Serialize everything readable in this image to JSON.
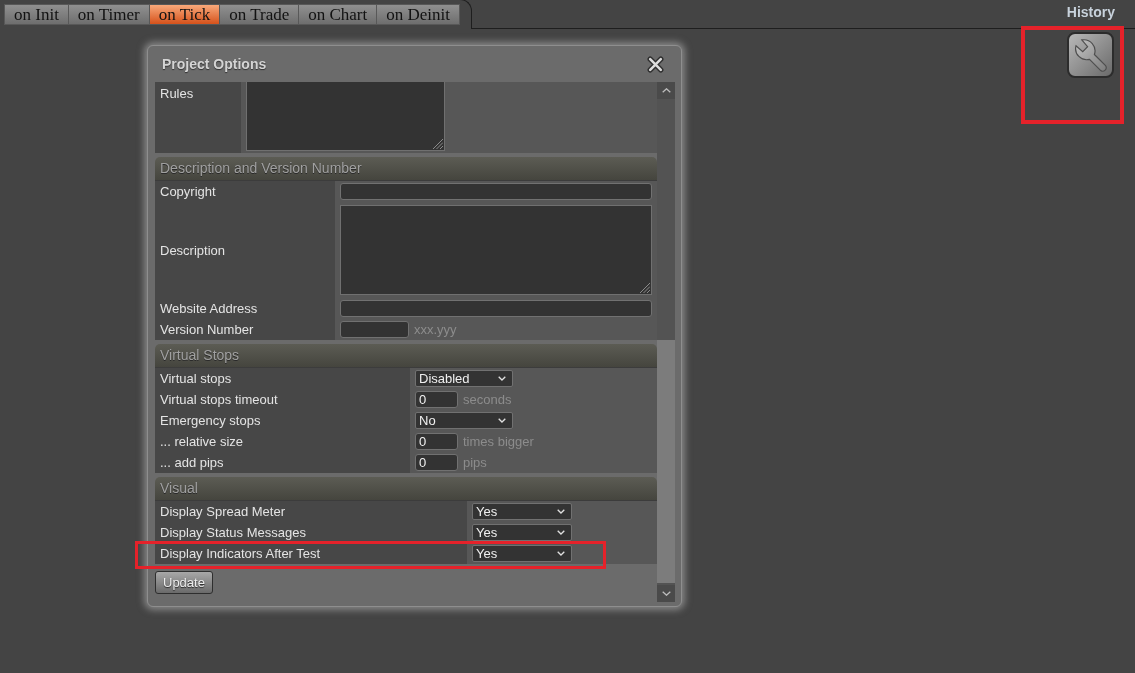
{
  "tabs": [
    {
      "label": "on Init",
      "selected": false
    },
    {
      "label": "on Timer",
      "selected": false
    },
    {
      "label": "on Tick",
      "selected": true
    },
    {
      "label": "on Trade",
      "selected": false
    },
    {
      "label": "on Chart",
      "selected": false
    },
    {
      "label": "on Deinit",
      "selected": false
    }
  ],
  "history": {
    "label": "History"
  },
  "settings_button": {
    "highlighted": true
  },
  "dialog": {
    "title": "Project Options",
    "sections": [
      {
        "rows": [
          {
            "label": "Rules",
            "kind": "textarea",
            "highlighted": false
          }
        ]
      },
      {
        "title": "Description and Version Number",
        "rows": [
          {
            "label": "Copyright",
            "kind": "text",
            "highlighted": false
          },
          {
            "label": "Description",
            "kind": "textarea",
            "highlighted": false
          },
          {
            "label": "Website Address",
            "kind": "text",
            "highlighted": false
          },
          {
            "label": "Version Number",
            "kind": "short",
            "suffix": "xxx.yyy",
            "highlighted": false
          }
        ]
      },
      {
        "title": "Virtual Stops",
        "rows": [
          {
            "label": "Virtual stops",
            "kind": "select",
            "value": "Disabled",
            "highlighted": false
          },
          {
            "label": "Virtual stops timeout",
            "kind": "number",
            "value": "0",
            "suffix": "seconds",
            "highlighted": false
          },
          {
            "label": "Emergency stops",
            "kind": "select",
            "value": "No",
            "highlighted": false
          },
          {
            "label": "... relative size",
            "kind": "number",
            "value": "0",
            "suffix": "times bigger",
            "highlighted": false
          },
          {
            "label": "... add pips",
            "kind": "number",
            "value": "0",
            "suffix": "pips",
            "highlighted": false
          }
        ]
      },
      {
        "title": "Visual",
        "rows": [
          {
            "label": "Display Spread Meter",
            "kind": "select",
            "value": "Yes",
            "highlighted": false
          },
          {
            "label": "Display Status Messages",
            "kind": "select",
            "value": "Yes",
            "highlighted": false
          },
          {
            "label": "Display Indicators After Test",
            "kind": "select",
            "value": "Yes",
            "highlighted": true
          }
        ]
      }
    ],
    "button": "Update"
  }
}
